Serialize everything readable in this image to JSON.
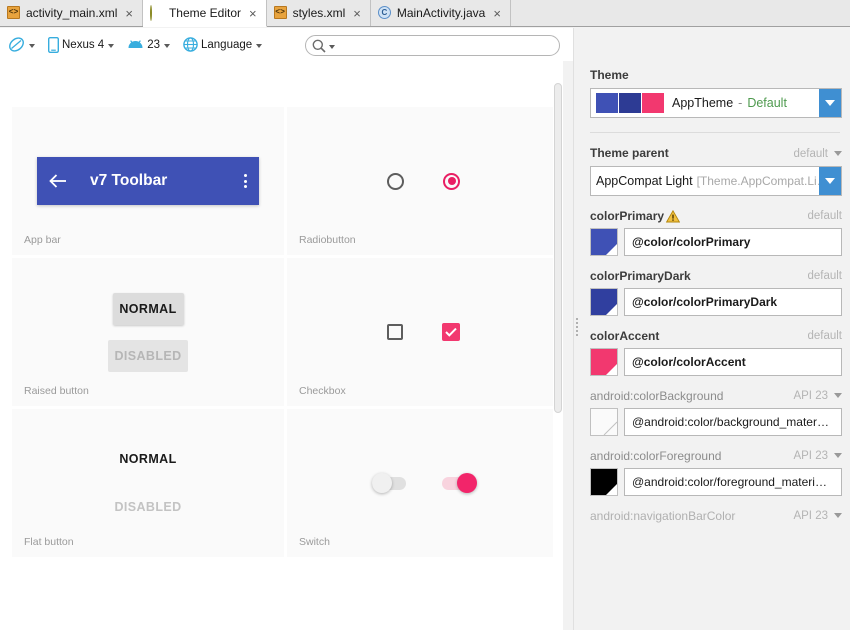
{
  "tabs": [
    {
      "label": "activity_main.xml",
      "icon": "xml-file-icon",
      "active": false,
      "close": "×"
    },
    {
      "label": "Theme Editor",
      "icon": "theme-editor-icon",
      "active": true,
      "close": "×"
    },
    {
      "label": "styles.xml",
      "icon": "xml-file-icon",
      "active": false,
      "close": "×"
    },
    {
      "label": "MainActivity.java",
      "icon": "java-class-icon",
      "active": false,
      "close": "×"
    }
  ],
  "toolbar": {
    "theme_toggle": "",
    "device": "Nexus 4",
    "api_level": "23",
    "language": "Language",
    "search_placeholder": ""
  },
  "preview": {
    "cards": [
      {
        "label": "App bar",
        "appbar_title": "v7 Toolbar",
        "back_icon": "arrow-back-icon",
        "overflow_icon": "overflow-menu-icon"
      },
      {
        "label": "Radiobutton"
      },
      {
        "label": "Raised button",
        "normal": "NORMAL",
        "disabled": "DISABLED"
      },
      {
        "label": "Checkbox"
      },
      {
        "label": "Flat button",
        "normal": "NORMAL",
        "disabled": "DISABLED"
      },
      {
        "label": "Switch"
      }
    ]
  },
  "right_panel": {
    "theme_section_title": "Theme",
    "theme_combo": {
      "name": "AppTheme",
      "dash": "-",
      "qualifier": "Default",
      "swatch_colors": [
        "#3f51b5",
        "#2d3b94",
        "#f2386f"
      ],
      "arrow_icon": "chevron-down-icon"
    },
    "theme_parent": {
      "label": "Theme parent",
      "status": "default",
      "value": "AppCompat Light",
      "value_sub": "[Theme.AppCompat.Li…",
      "arrow_icon": "chevron-down-icon"
    },
    "attributes": [
      {
        "name": "colorPrimary",
        "status": "default",
        "warning": true,
        "warning_icon": "warning-icon",
        "swatch": "#3f51b5",
        "value": "@color/colorPrimary",
        "bold": true,
        "has_dropdown": false
      },
      {
        "name": "colorPrimaryDark",
        "status": "default",
        "warning": false,
        "swatch": "#303f9f",
        "value": "@color/colorPrimaryDark",
        "bold": true,
        "has_dropdown": false
      },
      {
        "name": "colorAccent",
        "status": "default",
        "warning": false,
        "swatch": "#f2386f",
        "value": "@color/colorAccent",
        "bold": true,
        "has_dropdown": false
      },
      {
        "name": "android:colorBackground",
        "status": "API 23",
        "warning": false,
        "swatch": "#fafafa",
        "value": "@android:color/background_mater…",
        "bold": false,
        "has_dropdown": true
      },
      {
        "name": "android:colorForeground",
        "status": "API 23",
        "warning": false,
        "swatch": "#000000",
        "value": "@android:color/foreground_materi…",
        "bold": false,
        "has_dropdown": true
      },
      {
        "name": "android:navigationBarColor",
        "status": "API 23",
        "warning": false,
        "has_dropdown": true
      }
    ]
  },
  "colors": {
    "primary": "#3f51b5",
    "primary_dark": "#303f9f",
    "accent": "#f2386f",
    "panel_bg": "#f2f2f2",
    "card_bg": "#fafafa",
    "combo_arrow": "#3f8fd2"
  }
}
